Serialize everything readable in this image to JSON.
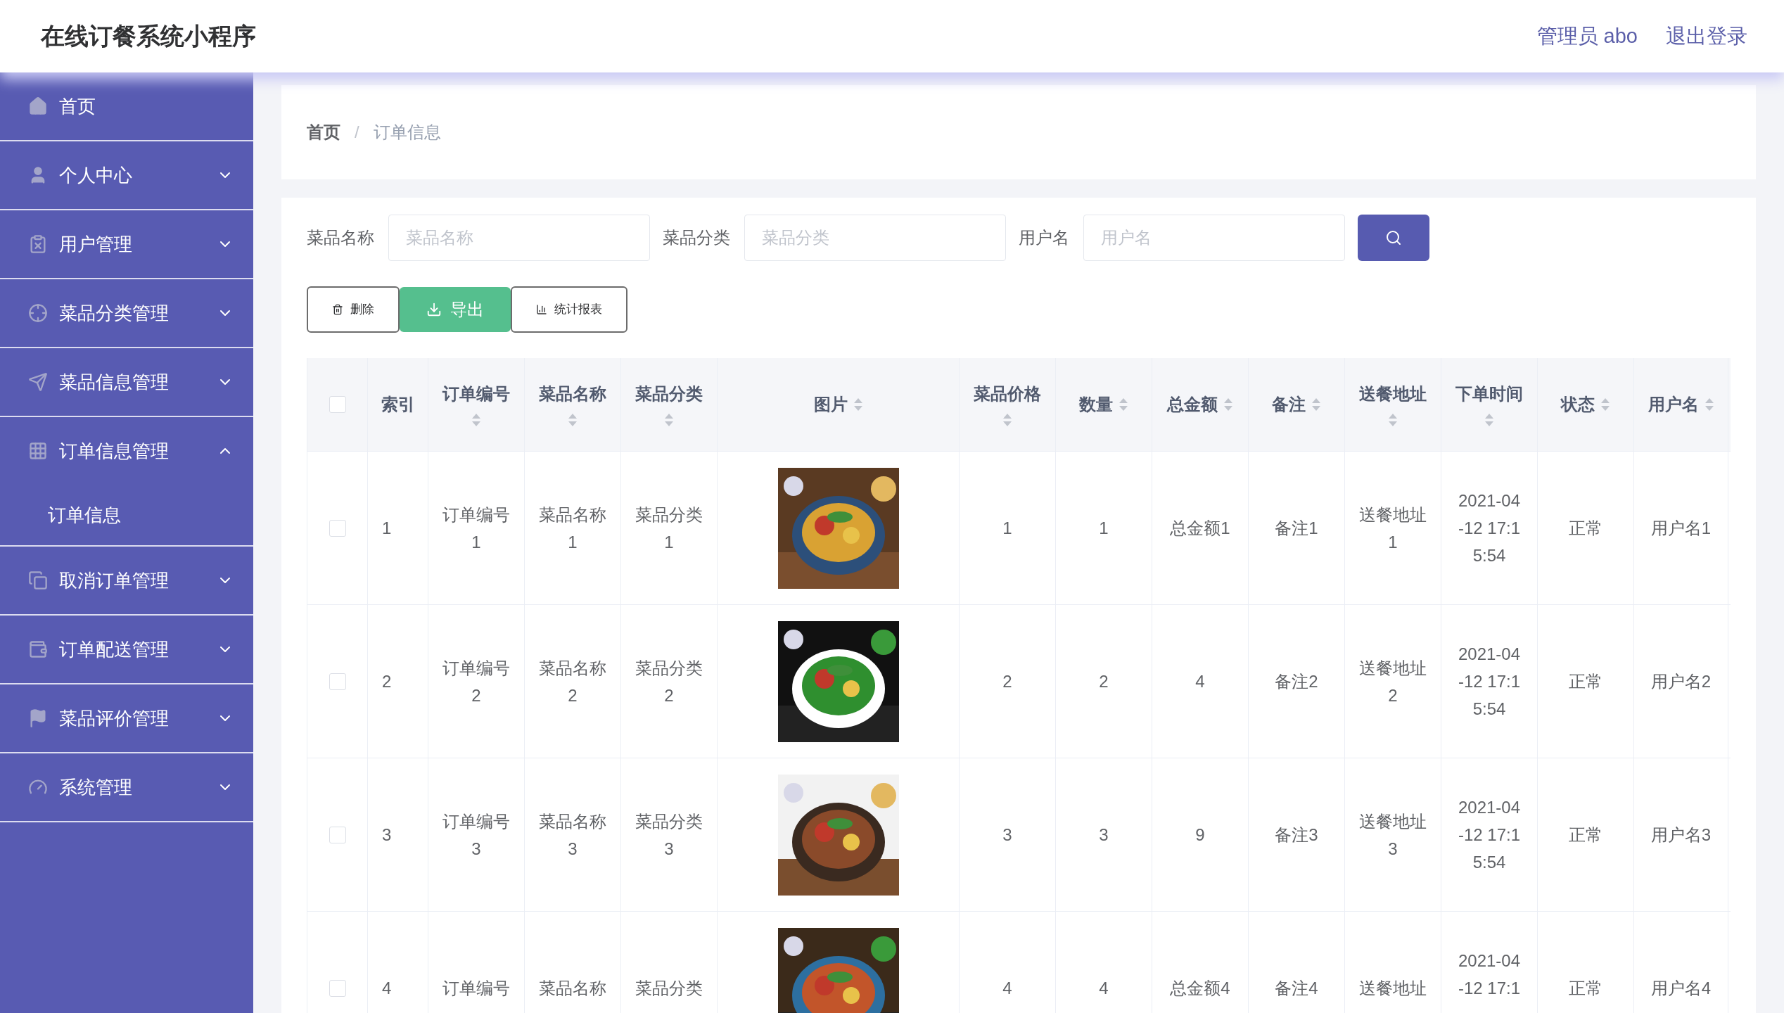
{
  "header": {
    "title": "在线订餐系统小程序",
    "user": "管理员 abo",
    "logout": "退出登录"
  },
  "sidebar": {
    "items": [
      {
        "label": "首页",
        "kind": "link"
      },
      {
        "label": "个人中心",
        "kind": "menu",
        "expanded": false
      },
      {
        "label": "用户管理",
        "kind": "menu",
        "expanded": false
      },
      {
        "label": "菜品分类管理",
        "kind": "menu",
        "expanded": false
      },
      {
        "label": "菜品信息管理",
        "kind": "menu",
        "expanded": false
      },
      {
        "label": "订单信息管理",
        "kind": "menu",
        "expanded": true,
        "children": [
          {
            "label": "订单信息"
          }
        ]
      },
      {
        "label": "取消订单管理",
        "kind": "menu",
        "expanded": false
      },
      {
        "label": "订单配送管理",
        "kind": "menu",
        "expanded": false
      },
      {
        "label": "菜品评价管理",
        "kind": "menu",
        "expanded": false
      },
      {
        "label": "系统管理",
        "kind": "menu",
        "expanded": false
      }
    ]
  },
  "breadcrumb": {
    "separator": "/",
    "items": [
      "首页",
      "订单信息"
    ]
  },
  "search": {
    "fields": [
      {
        "label": "菜品名称",
        "placeholder": "菜品名称"
      },
      {
        "label": "菜品分类",
        "placeholder": "菜品分类"
      },
      {
        "label": "用户名",
        "placeholder": "用户名"
      }
    ]
  },
  "actions": [
    {
      "label": "删除",
      "kind": "delete"
    },
    {
      "label": "导出",
      "kind": "export"
    },
    {
      "label": "统计报表",
      "kind": "report"
    }
  ],
  "table": {
    "select_all": {
      "checked": false
    },
    "columns": [
      {
        "label": "索引",
        "sortable": false
      },
      {
        "label": "订单编号",
        "sortable": true
      },
      {
        "label": "菜品名称",
        "sortable": true
      },
      {
        "label": "菜品分类",
        "sortable": true
      },
      {
        "label": "图片",
        "sortable": true
      },
      {
        "label": "菜品价格",
        "sortable": true
      },
      {
        "label": "数量",
        "sortable": true
      },
      {
        "label": "总金额",
        "sortable": true
      },
      {
        "label": "备注",
        "sortable": true
      },
      {
        "label": "送餐地址",
        "sortable": true
      },
      {
        "label": "下单时间",
        "sortable": true
      },
      {
        "label": "状态",
        "sortable": true
      },
      {
        "label": "用户名",
        "sortable": true
      }
    ],
    "rows": [
      {
        "checked": false,
        "cells": [
          "1",
          "订单编号1",
          "菜品名称1",
          "菜品分类1",
          {
            "kind": "picture"
          },
          "1",
          "1",
          "总金额1",
          "备注1",
          "送餐地址1",
          [
            "2021-04",
            "-12 17:1",
            "5:54"
          ],
          "正常",
          "用户名1"
        ]
      },
      {
        "checked": false,
        "cells": [
          "2",
          "订单编号2",
          "菜品名称2",
          "菜品分类2",
          {
            "kind": "picture"
          },
          "2",
          "2",
          "4",
          "备注2",
          "送餐地址2",
          [
            "2021-04",
            "-12 17:1",
            "5:54"
          ],
          "正常",
          "用户名2"
        ]
      },
      {
        "checked": false,
        "cells": [
          "3",
          "订单编号3",
          "菜品名称3",
          "菜品分类3",
          {
            "kind": "picture"
          },
          "3",
          "3",
          "9",
          "备注3",
          "送餐地址3",
          [
            "2021-04",
            "-12 17:1",
            "5:54"
          ],
          "正常",
          "用户名3"
        ]
      },
      {
        "checked": false,
        "cells": [
          "4",
          "订单编号",
          "菜品名称",
          "菜品分类",
          {
            "kind": "picture"
          },
          "4",
          "4",
          "总金额4",
          "备注4",
          "送餐地址",
          [
            "2021-04",
            "-12 17:1"
          ],
          "正常",
          "用户名4"
        ]
      }
    ]
  }
}
